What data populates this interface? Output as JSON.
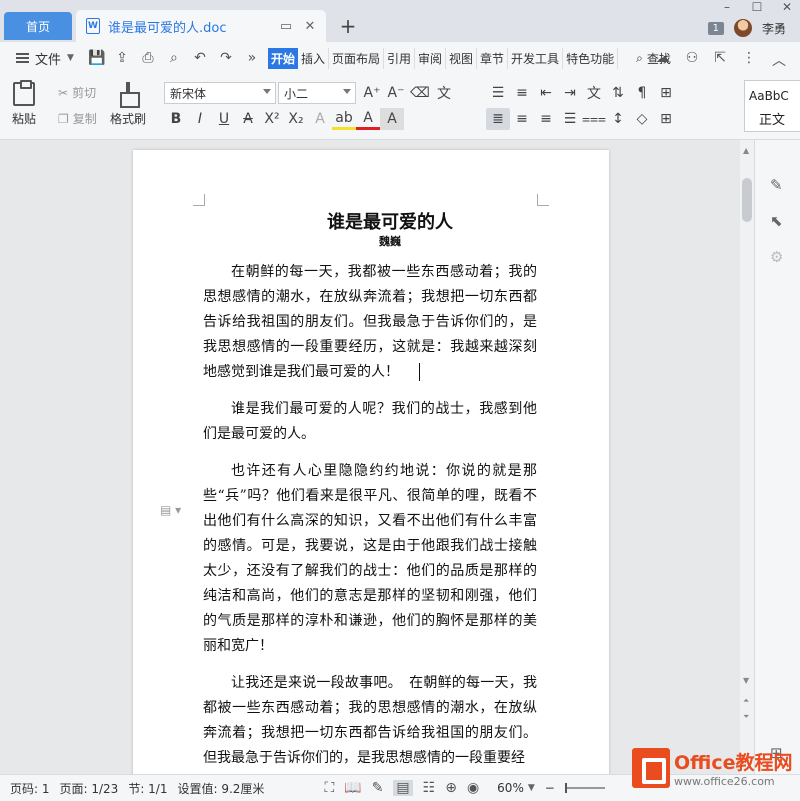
{
  "tabs": {
    "home": "首页",
    "document": "谁是最可爱的人.doc",
    "doc_icon": "W"
  },
  "window": {
    "tab_count": "1",
    "username": "李勇"
  },
  "menu": {
    "file": "文件",
    "tabs": [
      "开始",
      "插入",
      "页面布局",
      "引用",
      "审阅",
      "视图",
      "章节",
      "开发工具",
      "特色功能"
    ],
    "search": "查找"
  },
  "ribbon": {
    "paste": "粘贴",
    "cut": "剪切",
    "copy": "复制",
    "format_painter": "格式刷",
    "font_name": "新宋体",
    "font_size": "小二",
    "style_preview": "AaBbC",
    "style_name": "正文"
  },
  "document": {
    "title": "谁是最可爱的人",
    "author": "魏巍",
    "paragraphs": [
      "在朝鲜的每一天，我都被一些东西感动着；我的思想感情的潮水，在放纵奔流着；我想把一切东西都告诉给我祖国的朋友们。但我最急于告诉你们的，是我思想感情的一段重要经历，这就是：我越来越深刻地感觉到谁是我们最可爱的人！",
      "谁是我们最可爱的人呢？我们的战士，我感到他们是最可爱的人。",
      "也许还有人心里隐隐约约地说：你说的就是那些“兵”吗？他们看来是很平凡、很简单的哩，既看不出他们有什么高深的知识，又看不出他们有什么丰富的感情。可是，我要说，这是由于他跟我们战士接触太少，还没有了解我们的战士：他们的品质是那样的纯洁和高尚，他们的意志是那样的坚韧和刚强，他们的气质是那样的淳朴和谦逊，他们的胸怀是那样的美丽和宽广！",
      "让我还是来说一段故事吧。　在朝鲜的每一天，我都被一些东西感动着；我的思想感情的潮水，在放纵奔流着；我想把一切东西都告诉给我祖国的朋友们。但我最急于告诉你们的，是我思想感情的一段重要经"
    ]
  },
  "status": {
    "page_code": "页码: 1",
    "pages": "页面: 1/23",
    "section": "节: 1/1",
    "setting": "设置值: 9.2厘米",
    "zoom": "60%"
  },
  "watermark": {
    "line1": "Office教程网",
    "line2": "www.office26.com"
  }
}
